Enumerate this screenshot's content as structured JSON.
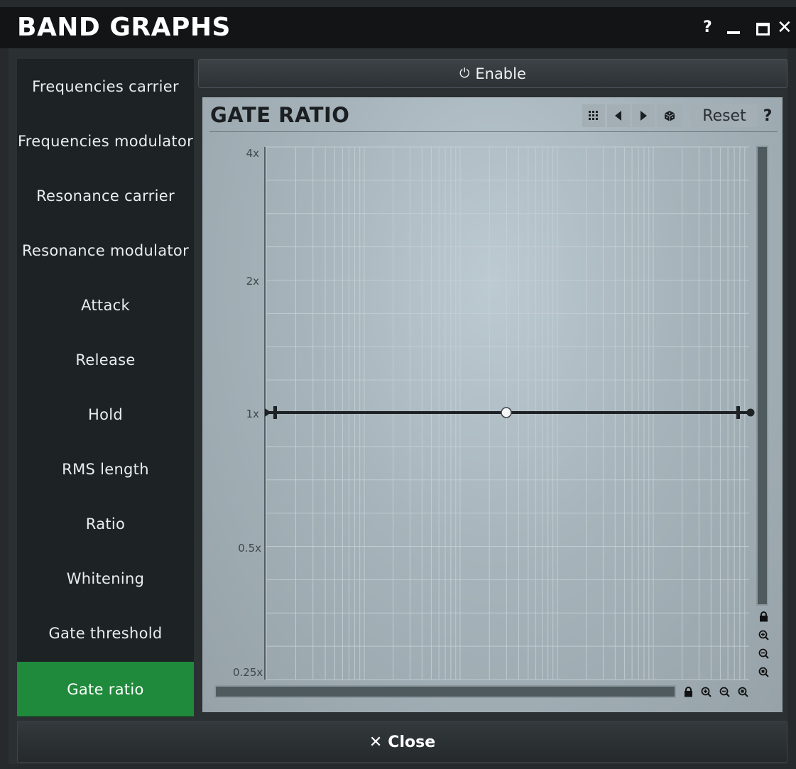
{
  "window": {
    "title": "BAND GRAPHS",
    "help_label": "?",
    "minimize_label": "",
    "maximize_label": "",
    "close_label": "✕"
  },
  "sidebar": {
    "items": [
      {
        "label": "Frequencies carrier"
      },
      {
        "label": "Frequencies modulator"
      },
      {
        "label": "Resonance carrier"
      },
      {
        "label": "Resonance modulator"
      },
      {
        "label": "Attack"
      },
      {
        "label": "Release"
      },
      {
        "label": "Hold"
      },
      {
        "label": "RMS length"
      },
      {
        "label": "Ratio"
      },
      {
        "label": "Whitening"
      },
      {
        "label": "Gate threshold"
      },
      {
        "label": "Gate ratio"
      }
    ],
    "active_index": 11,
    "active_color": "#1f8a3b"
  },
  "enable": {
    "label": "Enable",
    "icon": "power-icon"
  },
  "graph": {
    "title": "GATE RATIO",
    "toolbar": {
      "grid_icon": "grid-icon",
      "prev_icon": "triangle-left-icon",
      "next_icon": "triangle-right-icon",
      "random_icon": "dice-icon",
      "reset_label": "Reset",
      "help_label": "?"
    },
    "y_axis": {
      "scale": "log",
      "labels": [
        "4x",
        "2x",
        "1x",
        "0.5x",
        "0.25x"
      ],
      "range": [
        0.25,
        4
      ]
    },
    "curve": {
      "value": 1,
      "label": "1x"
    },
    "zoom_icons": [
      "lock-icon",
      "zoom-in-icon",
      "zoom-out-icon",
      "zoom-reset-icon"
    ]
  },
  "close": {
    "label": "Close",
    "icon": "close-icon"
  }
}
